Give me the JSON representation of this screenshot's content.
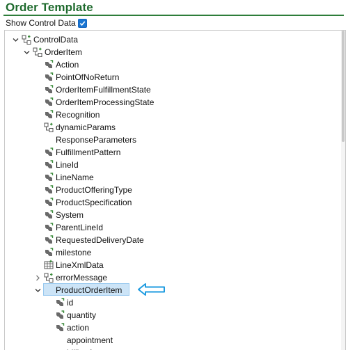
{
  "header": {
    "title": "Order Template",
    "show_control_label": "Show Control Data",
    "show_control_checked": true
  },
  "tree": [
    {
      "label": "ControlData",
      "level": 0,
      "expander": "expanded",
      "icon": "group-node-icon"
    },
    {
      "label": "OrderItem",
      "level": 1,
      "expander": "expanded",
      "icon": "group-node-icon"
    },
    {
      "label": "Action",
      "level": 2,
      "expander": "none",
      "icon": "data-element-icon"
    },
    {
      "label": "PointOfNoReturn",
      "level": 2,
      "expander": "none",
      "icon": "data-element-icon"
    },
    {
      "label": "OrderItemFulfillmentState",
      "level": 2,
      "expander": "none",
      "icon": "data-element-icon"
    },
    {
      "label": "OrderItemProcessingState",
      "level": 2,
      "expander": "none",
      "icon": "data-element-icon"
    },
    {
      "label": "Recognition",
      "level": 2,
      "expander": "none",
      "icon": "data-element-icon"
    },
    {
      "label": "dynamicParams",
      "level": 2,
      "expander": "none",
      "icon": "group-node-icon"
    },
    {
      "label": "ResponseParameters",
      "level": 2,
      "expander": "none",
      "icon": "none"
    },
    {
      "label": "FulfillmentPattern",
      "level": 2,
      "expander": "none",
      "icon": "data-element-icon"
    },
    {
      "label": "LineId",
      "level": 2,
      "expander": "none",
      "icon": "data-element-icon"
    },
    {
      "label": "LineName",
      "level": 2,
      "expander": "none",
      "icon": "data-element-icon"
    },
    {
      "label": "ProductOfferingType",
      "level": 2,
      "expander": "none",
      "icon": "data-element-icon"
    },
    {
      "label": "ProductSpecification",
      "level": 2,
      "expander": "none",
      "icon": "data-element-icon"
    },
    {
      "label": "System",
      "level": 2,
      "expander": "none",
      "icon": "data-element-icon"
    },
    {
      "label": "ParentLineId",
      "level": 2,
      "expander": "none",
      "icon": "data-element-icon"
    },
    {
      "label": "RequestedDeliveryDate",
      "level": 2,
      "expander": "none",
      "icon": "data-element-icon"
    },
    {
      "label": "milestone",
      "level": 2,
      "expander": "none",
      "icon": "data-element-icon"
    },
    {
      "label": "LineXmlData",
      "level": 2,
      "expander": "none",
      "icon": "xml-data-icon"
    },
    {
      "label": "errorMessage",
      "level": 2,
      "expander": "collapsed",
      "icon": "group-node-icon"
    },
    {
      "label": "ProductOrderItem",
      "level": 2,
      "expander": "expanded",
      "icon": "none",
      "selected": true
    },
    {
      "label": "id",
      "level": 3,
      "expander": "none",
      "icon": "data-element-icon"
    },
    {
      "label": "quantity",
      "level": 3,
      "expander": "none",
      "icon": "data-element-icon"
    },
    {
      "label": "action",
      "level": 3,
      "expander": "none",
      "icon": "data-element-icon"
    },
    {
      "label": "appointment",
      "level": 3,
      "expander": "none",
      "icon": "none"
    },
    {
      "label": "billingAccount",
      "level": 3,
      "expander": "none",
      "icon": "none"
    }
  ],
  "colors": {
    "title": "#1f6b2e",
    "selection_bg": "#cce4f7",
    "callout_arrow": "#1e9be0",
    "icon_gray": "#555555",
    "icon_green": "#3a8a3a"
  }
}
